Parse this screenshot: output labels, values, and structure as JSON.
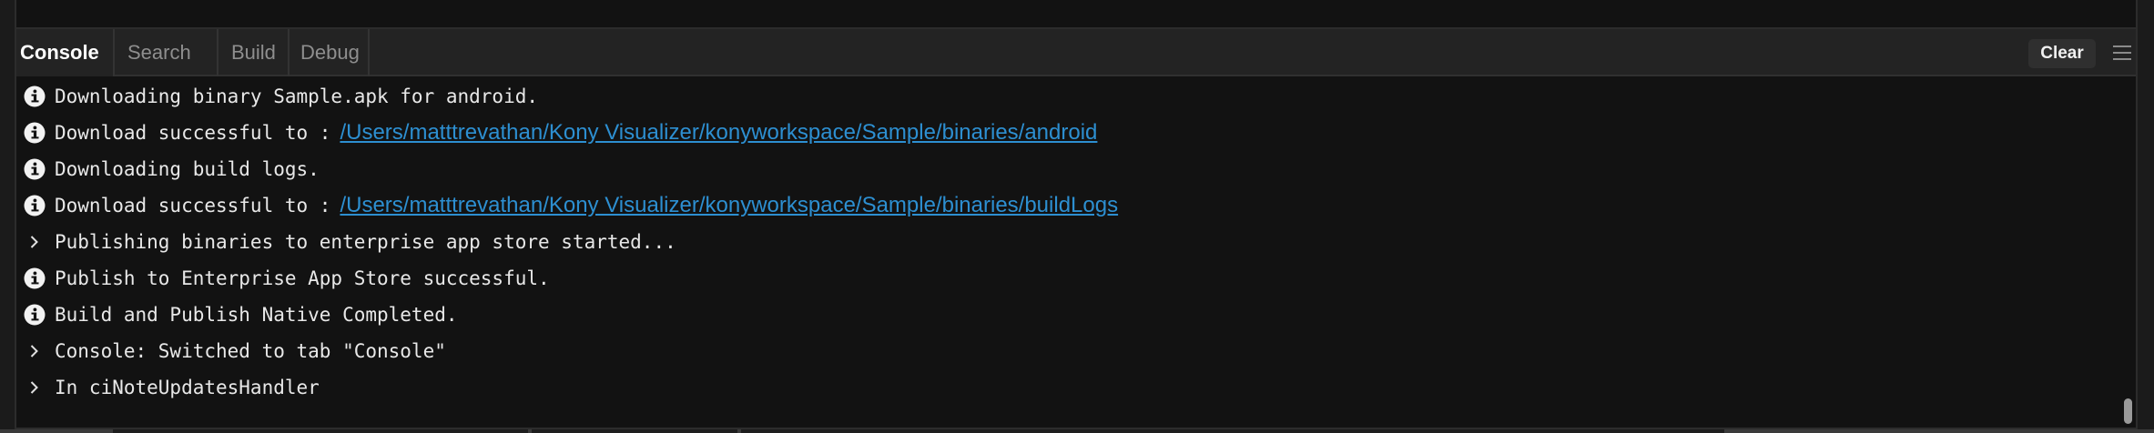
{
  "tabs": [
    {
      "label": "Console",
      "active": true
    },
    {
      "label": "Search",
      "active": false
    },
    {
      "label": "Build",
      "active": false
    },
    {
      "label": "Debug",
      "active": false
    }
  ],
  "toolbar": {
    "clear_label": "Clear",
    "menu_icon": "hamburger-menu-icon"
  },
  "log": [
    {
      "icon": "info-icon",
      "text": "Downloading binary Sample.apk for android.",
      "link": ""
    },
    {
      "icon": "info-icon",
      "text": "Download successful to :",
      "link": "/Users/matttrevathan/Kony Visualizer/konyworkspace/Sample/binaries/android"
    },
    {
      "icon": "info-icon",
      "text": "Downloading build logs.",
      "link": ""
    },
    {
      "icon": "info-icon",
      "text": "Download successful to :",
      "link": "/Users/matttrevathan/Kony Visualizer/konyworkspace/Sample/binaries/buildLogs"
    },
    {
      "icon": "chevron-right-icon",
      "text": "Publishing binaries to enterprise app store started...",
      "link": ""
    },
    {
      "icon": "info-icon",
      "text": "Publish to Enterprise App Store successful.",
      "link": ""
    },
    {
      "icon": "info-icon",
      "text": "Build and Publish Native Completed.",
      "link": ""
    },
    {
      "icon": "chevron-right-icon",
      "text": "Console: Switched to tab \"Console\"",
      "link": ""
    },
    {
      "icon": "chevron-right-icon",
      "text": "In ciNoteUpdatesHandler",
      "link": ""
    }
  ],
  "colors": {
    "link": "#2d8fd1",
    "text": "#e8e8e8",
    "background": "#121212"
  }
}
